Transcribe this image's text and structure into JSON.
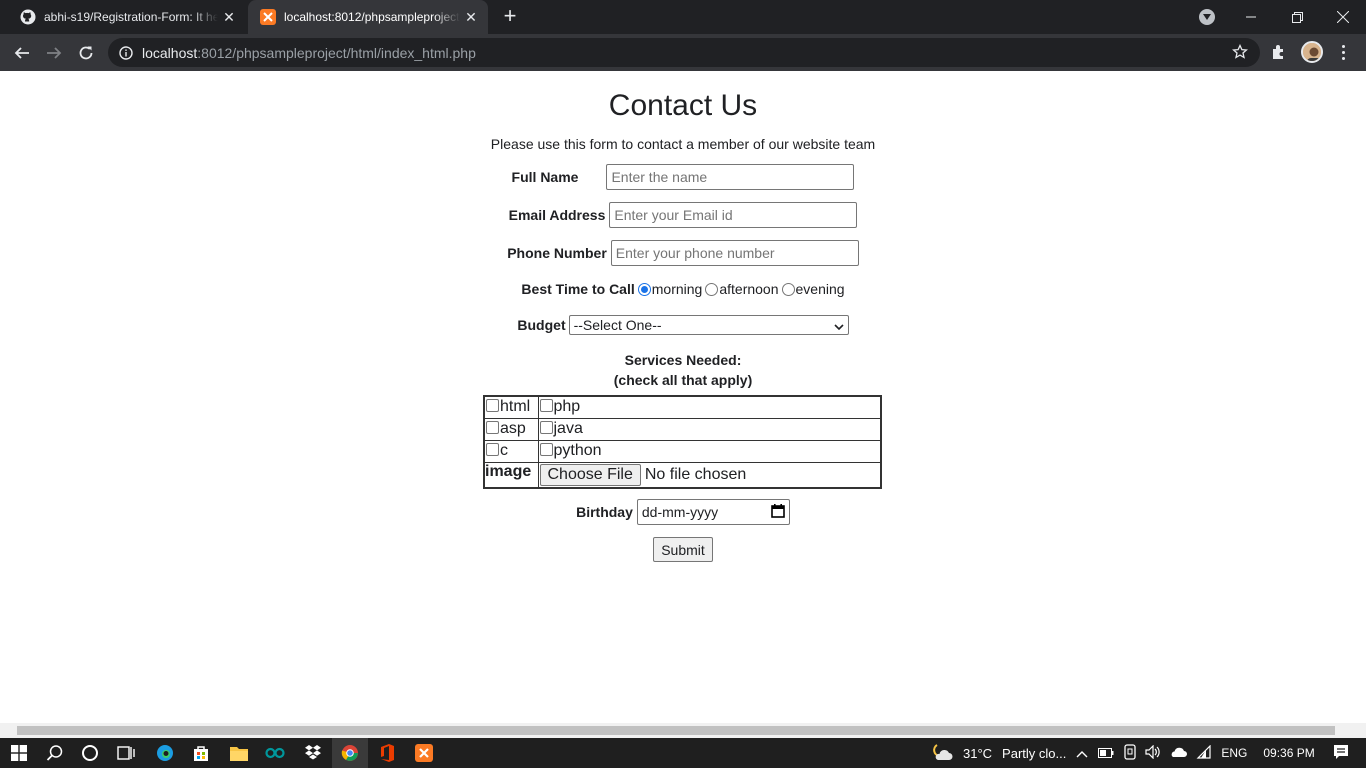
{
  "browser": {
    "tabs": [
      {
        "title": "abhi-s19/Registration-Form: It he",
        "icon": "github-icon"
      },
      {
        "title": "localhost:8012/phpsampleproject",
        "icon": "xampp-icon"
      }
    ],
    "url_host": "localhost",
    "url_rest": ":8012/phpsampleproject/html/index_html.php"
  },
  "form": {
    "heading": "Contact Us",
    "subtitle": "Please use this form to contact a member of our website team",
    "full_name": {
      "label": "Full Name",
      "placeholder": "Enter the name"
    },
    "email": {
      "label": "Email Address",
      "placeholder": "Enter your Email id"
    },
    "phone": {
      "label": "Phone Number",
      "placeholder": "Enter your phone number"
    },
    "best_time": {
      "label": "Best Time to Call",
      "options": [
        "morning",
        "afternoon",
        "evening"
      ],
      "selected": "morning"
    },
    "budget": {
      "label": "Budget",
      "selected": "--Select One--"
    },
    "services_title_line1": "Services Needed:",
    "services_title_line2": "(check all that apply)",
    "services": [
      [
        "html",
        "php"
      ],
      [
        "asp",
        "java"
      ],
      [
        "c",
        "python"
      ]
    ],
    "image": {
      "label": "image",
      "button": "Choose File",
      "status": "No file chosen"
    },
    "birthday": {
      "label": "Birthday",
      "placeholder": "dd-mm-yyyy"
    },
    "submit": "Submit"
  },
  "taskbar": {
    "weather_temp": "31°C",
    "weather_text": "Partly clo...",
    "language": "ENG",
    "time": "09:36 PM"
  },
  "colors": {
    "chrome_dark": "#202124",
    "chrome_toolbar": "#35363a",
    "radio_accent": "#1a73e8",
    "taskbar": "#1f1f1f"
  }
}
